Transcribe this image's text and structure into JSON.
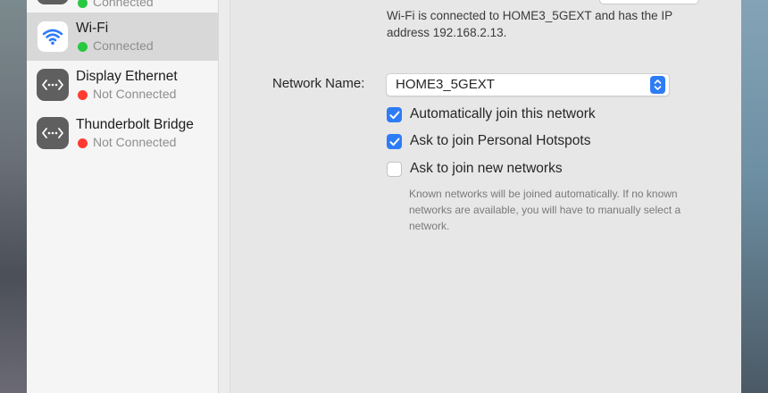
{
  "sidebar": {
    "items": [
      {
        "name": "",
        "status": "Connected",
        "status_color": "#28c840",
        "icon": "top-service-icon"
      },
      {
        "name": "Wi-Fi",
        "status": "Connected",
        "status_color": "#28c840",
        "icon": "wifi-icon",
        "selected": true
      },
      {
        "name": "Display Ethernet",
        "status": "Not Connected",
        "status_color": "#ff3b30",
        "icon": "ethernet-icon"
      },
      {
        "name": "Thunderbolt Bridge",
        "status": "Not Connected",
        "status_color": "#ff3b30",
        "icon": "ethernet-icon"
      }
    ]
  },
  "main": {
    "status_text": "Wi-Fi is connected to HOME3_5GEXT and has the IP address 192.168.2.13.",
    "network_name_label": "Network Name:",
    "network_name_value": "HOME3_5GEXT",
    "options": [
      {
        "label": "Automatically join this network",
        "checked": true
      },
      {
        "label": "Ask to join Personal Hotspots",
        "checked": true
      },
      {
        "label": "Ask to join new networks",
        "checked": false
      }
    ],
    "help_text": "Known networks will be joined automatically. If no known networks are available, you will have to manually select a network."
  },
  "colors": {
    "accent": "#2d7cf6",
    "connected": "#28c840",
    "not_connected": "#ff3b30"
  }
}
